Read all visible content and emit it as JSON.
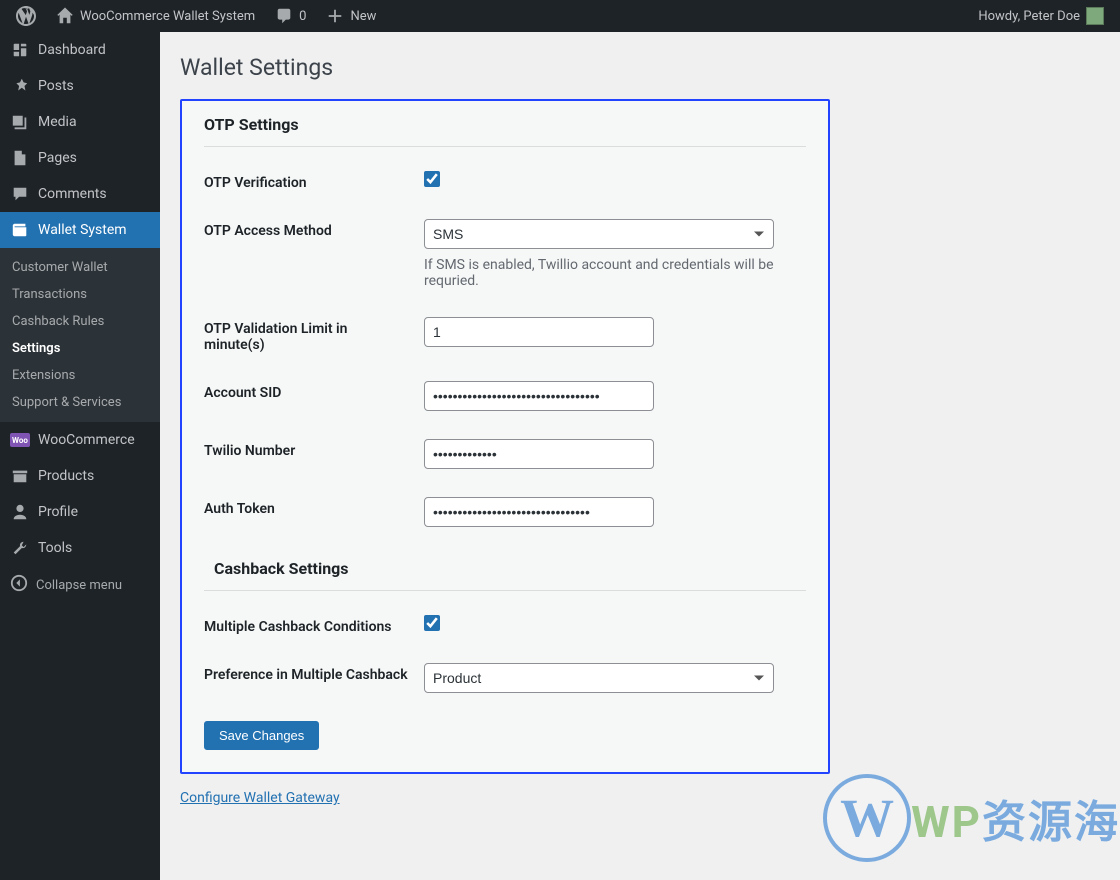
{
  "adminbar": {
    "site_title": "WooCommerce Wallet System",
    "comments_count": "0",
    "new_label": "New",
    "greeting": "Howdy, Peter Doe"
  },
  "sidebar": {
    "dashboard": "Dashboard",
    "posts": "Posts",
    "media": "Media",
    "pages": "Pages",
    "comments": "Comments",
    "wallet_system": "Wallet System",
    "sub": {
      "customer_wallet": "Customer Wallet",
      "transactions": "Transactions",
      "cashback_rules": "Cashback Rules",
      "settings": "Settings",
      "extensions": "Extensions",
      "support": "Support & Services"
    },
    "woocommerce": "WooCommerce",
    "products": "Products",
    "profile": "Profile",
    "tools": "Tools",
    "collapse": "Collapse menu"
  },
  "page": {
    "title": "Wallet Settings",
    "section_otp": "OTP Settings",
    "section_cashback": "Cashback Settings",
    "labels": {
      "otp_verification": "OTP Verification",
      "otp_access_method": "OTP Access Method",
      "otp_validation_limit": "OTP Validation Limit in minute(s)",
      "account_sid": "Account SID",
      "twilio_number": "Twilio Number",
      "auth_token": "Auth Token",
      "multiple_cashback": "Multiple Cashback Conditions",
      "preference": "Preference in Multiple Cashback"
    },
    "values": {
      "otp_access_method": "SMS",
      "otp_validation_limit": "1",
      "preference": "Product"
    },
    "help": {
      "sms": "If SMS is enabled, Twillio account and credentials will be requried."
    },
    "save_label": "Save Changes",
    "gateway_link": "Configure Wallet Gateway"
  },
  "watermark": {
    "text1": "WP",
    "text2": "资源海"
  }
}
